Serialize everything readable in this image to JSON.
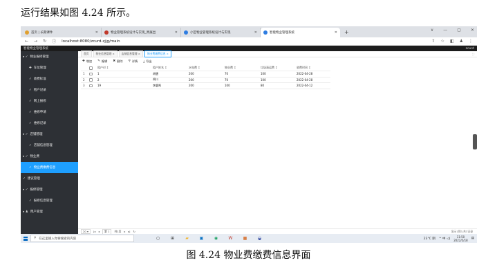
{
  "doc": {
    "intro": "运行结果如图 4.24 所示。",
    "caption": "图 4.24 物业费缴费信息界面"
  },
  "browser": {
    "tabs": [
      {
        "title": "首页 | 长期课件",
        "color": "#e0a030"
      },
      {
        "title": "物业管理系统设计与实现_周展出",
        "color": "#c0392b"
      },
      {
        "title": "小区物业管理系统设计与实现",
        "color": "#2f7de1"
      },
      {
        "title": "智能物业管理系统",
        "color": "#2f7de1"
      }
    ],
    "new_tab": "+",
    "url": "localhost:8080/zcurd-zjjg/main",
    "win_controls": [
      "∨",
      "—",
      "▢",
      "✕"
    ]
  },
  "app": {
    "title": "智能物业管理系统",
    "user": "zcurd"
  },
  "sidebar": {
    "items": [
      {
        "label": "物业报修管理",
        "type": "group",
        "icon": "▸ ✓"
      },
      {
        "label": "车位管理",
        "type": "sub",
        "icon": "✚"
      },
      {
        "label": "收费标准",
        "type": "sub",
        "icon": "✓"
      },
      {
        "label": "租户记录",
        "type": "sub",
        "icon": "✓"
      },
      {
        "label": "网上报修",
        "type": "sub",
        "icon": "✓"
      },
      {
        "label": "维修申请",
        "type": "sub",
        "icon": "✓"
      },
      {
        "label": "维修记录",
        "type": "sub",
        "icon": "✓"
      },
      {
        "label": "店铺管理",
        "type": "group",
        "icon": "▸ ✓"
      },
      {
        "label": "店铺信息管理",
        "type": "sub",
        "icon": "✓"
      },
      {
        "label": "物业费",
        "type": "group",
        "icon": "▸ ✓"
      },
      {
        "label": "物业费缴费信息",
        "type": "sub",
        "icon": "✓",
        "active": true
      },
      {
        "label": "建议管理",
        "type": "group",
        "icon": "✓"
      },
      {
        "label": "报修管理",
        "type": "group",
        "icon": "▸ ✓"
      },
      {
        "label": "报修信息管理",
        "type": "sub",
        "icon": "✓"
      },
      {
        "label": "用户管理",
        "type": "group",
        "icon": "▸ ♟"
      }
    ]
  },
  "page_tabs": [
    {
      "label": "首页"
    },
    {
      "label": "物业信息管理 ×"
    },
    {
      "label": "店铺信息管理 ×"
    },
    {
      "label": "物业费缴费信息 ×",
      "active": true
    }
  ],
  "page_tools": "⛶",
  "toolbar": [
    {
      "icon": "✚",
      "label": "增加"
    },
    {
      "icon": "✎",
      "label": "编辑"
    },
    {
      "icon": "✖",
      "label": "删除"
    },
    {
      "icon": "⚲",
      "label": "详情"
    },
    {
      "icon": "⤓",
      "label": "导出"
    }
  ],
  "table": {
    "columns": [
      "租户id ↕",
      "租户姓名 ↕",
      "水电费 ↕",
      "物业费 ↕",
      "垃圾清运费 ↕",
      "收费时间 ↕"
    ],
    "rows": [
      {
        "n": "1",
        "cells": [
          "1",
          "胡唐",
          "200",
          "70",
          "100",
          "2022-04-28"
        ]
      },
      {
        "n": "2",
        "cells": [
          "2",
          "胡川",
          "200",
          "70",
          "100",
          "2022-04-28"
        ]
      },
      {
        "n": "3",
        "cells": [
          "19",
          "李鹿鸣",
          "200",
          "100",
          "80",
          "2022-04-12"
        ]
      }
    ]
  },
  "pager": {
    "page_size": "20 ▾",
    "first": "|◂",
    "prev": "◂",
    "page_label": "第 1",
    "total_label": "共1页",
    "next": "▸",
    "last": "▸|",
    "refresh": "↻",
    "range": "显示1到3,共3记录"
  },
  "taskbar": {
    "search_placeholder": "在这里输入你要搜索的内容",
    "apps": [
      {
        "glyph": "○",
        "color": "#333333"
      },
      {
        "glyph": "⊞",
        "color": "#333333"
      },
      {
        "glyph": "▰",
        "color": "#f2b632"
      },
      {
        "glyph": "▣",
        "color": "#0a72c4"
      },
      {
        "glyph": "◉",
        "color": "#1aa260"
      },
      {
        "glyph": "W",
        "color": "#c0392b"
      },
      {
        "glyph": "▦",
        "color": "#d35400"
      },
      {
        "glyph": "◒",
        "color": "#1e3799"
      }
    ],
    "weather": "23°C 阴",
    "tray_icons": "^ 中 ◁)",
    "time": "11:50",
    "date": "2022/5/18"
  }
}
